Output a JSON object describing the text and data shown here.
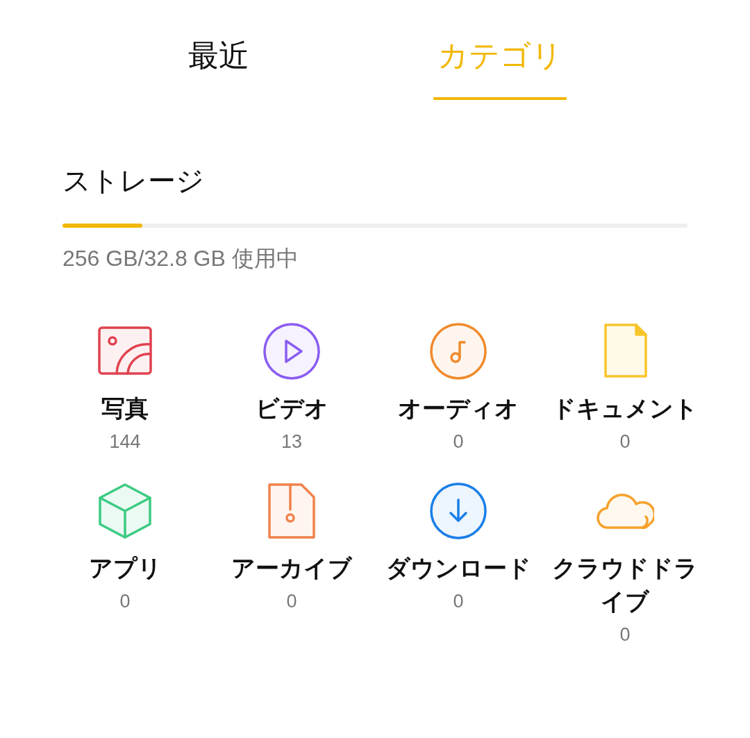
{
  "tabs": [
    {
      "label": "最近",
      "selected": false
    },
    {
      "label": "カテゴリ",
      "selected": true
    }
  ],
  "storage": {
    "title": "ストレージ",
    "level": 0.128,
    "usage": "256 GB/32.8 GB 使用中"
  },
  "categories": [
    {
      "kind": "photo",
      "label": "写真",
      "count": "144",
      "color": "#e0424f"
    },
    {
      "kind": "video",
      "label": "ビデオ",
      "count": "13",
      "color": "#8a5cf0"
    },
    {
      "kind": "audio",
      "label": "オーディオ",
      "count": "0",
      "color": "#f08a2c"
    },
    {
      "kind": "document",
      "label": "ドキュメント",
      "count": "0",
      "color": "#f7c52b"
    },
    {
      "kind": "app",
      "label": "アプリ",
      "count": "0",
      "color": "#3ccb82"
    },
    {
      "kind": "archive",
      "label": "アーカイブ",
      "count": "0",
      "color": "#f0824a"
    },
    {
      "kind": "download",
      "label": "ダウンロード",
      "count": "0",
      "color": "#1a7fe8"
    },
    {
      "kind": "cloud",
      "label": "クラウドドライブ",
      "count": "0",
      "color": "#f5a12c"
    }
  ]
}
